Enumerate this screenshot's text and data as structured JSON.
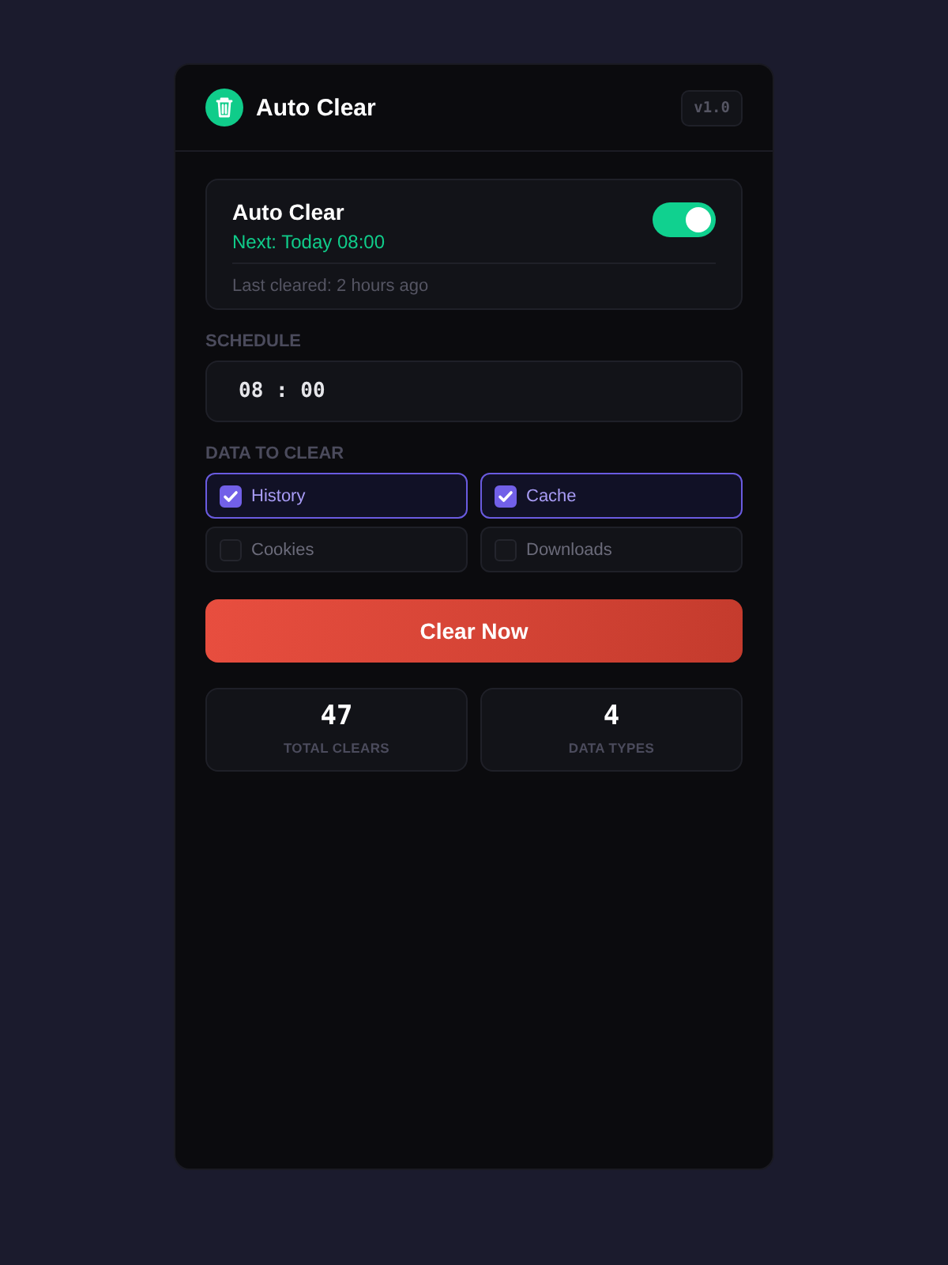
{
  "header": {
    "title": "Auto Clear",
    "version": "v1.0"
  },
  "status": {
    "title": "Auto Clear",
    "next": "Next: Today 08:00",
    "last_cleared": "Last cleared: 2 hours ago",
    "on": true
  },
  "schedule": {
    "label": "SCHEDULE",
    "time": "08 : 00"
  },
  "data_to_clear": {
    "label": "DATA TO CLEAR",
    "items": [
      {
        "label": "History",
        "checked": true
      },
      {
        "label": "Cache",
        "checked": true
      },
      {
        "label": "Cookies",
        "checked": false
      },
      {
        "label": "Downloads",
        "checked": false
      }
    ]
  },
  "clear_button": "Clear Now",
  "stats": [
    {
      "value": "47",
      "label": "TOTAL CLEARS"
    },
    {
      "value": "4",
      "label": "DATA TYPES"
    }
  ]
}
